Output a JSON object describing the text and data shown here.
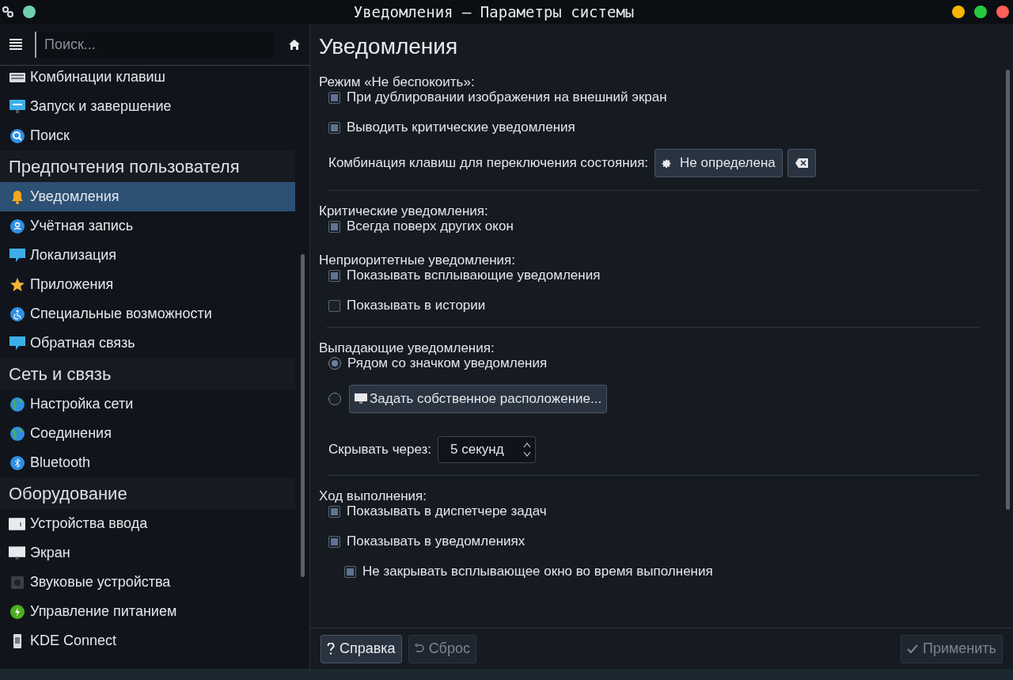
{
  "window": {
    "title": "Уведомления — Параметры системы"
  },
  "search": {
    "placeholder": "Поиск..."
  },
  "sidebar": {
    "items": [
      {
        "kind": "item",
        "label": "Комбинации клавиш",
        "selected": false
      },
      {
        "kind": "item",
        "label": "Запуск и завершение",
        "selected": false
      },
      {
        "kind": "item",
        "label": "Поиск",
        "selected": false
      },
      {
        "kind": "header",
        "label": "Предпочтения пользователя"
      },
      {
        "kind": "item",
        "label": "Уведомления",
        "selected": true
      },
      {
        "kind": "item",
        "label": "Учётная запись",
        "selected": false
      },
      {
        "kind": "item",
        "label": "Локализация",
        "selected": false
      },
      {
        "kind": "item",
        "label": "Приложения",
        "selected": false
      },
      {
        "kind": "item",
        "label": "Специальные возможности",
        "selected": false
      },
      {
        "kind": "item",
        "label": "Обратная связь",
        "selected": false
      },
      {
        "kind": "header",
        "label": "Сеть и связь"
      },
      {
        "kind": "item",
        "label": "Настройка сети",
        "selected": false
      },
      {
        "kind": "item",
        "label": "Соединения",
        "selected": false
      },
      {
        "kind": "item",
        "label": "Bluetooth",
        "selected": false
      },
      {
        "kind": "header",
        "label": "Оборудование"
      },
      {
        "kind": "item",
        "label": "Устройства ввода",
        "selected": false
      },
      {
        "kind": "item",
        "label": "Экран",
        "selected": false
      },
      {
        "kind": "item",
        "label": "Звуковые устройства",
        "selected": false
      },
      {
        "kind": "item",
        "label": "Управление питанием",
        "selected": false
      },
      {
        "kind": "item",
        "label": "KDE Connect",
        "selected": false
      }
    ]
  },
  "page": {
    "title": "Уведомления",
    "sections": [
      {
        "title": "Режим «Не беспокоить»:",
        "divider": true,
        "items": [
          {
            "kind": "checkbox",
            "label": "При дублировании изображения на внешний экран",
            "checked": true
          },
          {
            "kind": "checkbox",
            "label": "Выводить критические уведомления",
            "checked": true
          },
          {
            "kind": "shortcut",
            "label": "Комбинация клавиш для переключения состояния:",
            "value": "Не определена"
          }
        ]
      },
      {
        "title": "Критические уведомления:",
        "divider": false,
        "items": [
          {
            "kind": "checkbox",
            "label": "Всегда поверх других окон",
            "checked": true
          }
        ]
      },
      {
        "title": "Неприоритетные уведомления:",
        "divider": true,
        "items": [
          {
            "kind": "checkbox",
            "label": "Показывать всплывающие уведомления",
            "checked": true
          },
          {
            "kind": "checkbox",
            "label": "Показывать в истории",
            "checked": false
          }
        ]
      },
      {
        "title": "Выпадающие уведомления:",
        "divider": true,
        "items": [
          {
            "kind": "radio",
            "label": "Рядом со значком уведомления",
            "selected": true
          },
          {
            "kind": "radio_button",
            "label": "Задать собственное расположение...",
            "selected": false
          },
          {
            "kind": "spin",
            "label": "Скрывать через:",
            "value": "5 секунд"
          }
        ]
      },
      {
        "title": "Ход выполнения:",
        "divider": false,
        "items": [
          {
            "kind": "checkbox",
            "label": "Показывать в диспетчере задач",
            "checked": true
          },
          {
            "kind": "checkbox",
            "label": "Показывать в уведомлениях",
            "checked": true,
            "children": [
              {
                "kind": "checkbox",
                "label": "Не закрывать всплывающее окно во время выполнения",
                "checked": true
              }
            ]
          }
        ]
      }
    ]
  },
  "buttons": [
    {
      "kind": "help",
      "label": "Справка",
      "disabled": false
    },
    {
      "kind": "reset",
      "label": "Сброс",
      "disabled": true
    },
    {
      "kind": "apply",
      "label": "Применить",
      "disabled": true
    }
  ]
}
